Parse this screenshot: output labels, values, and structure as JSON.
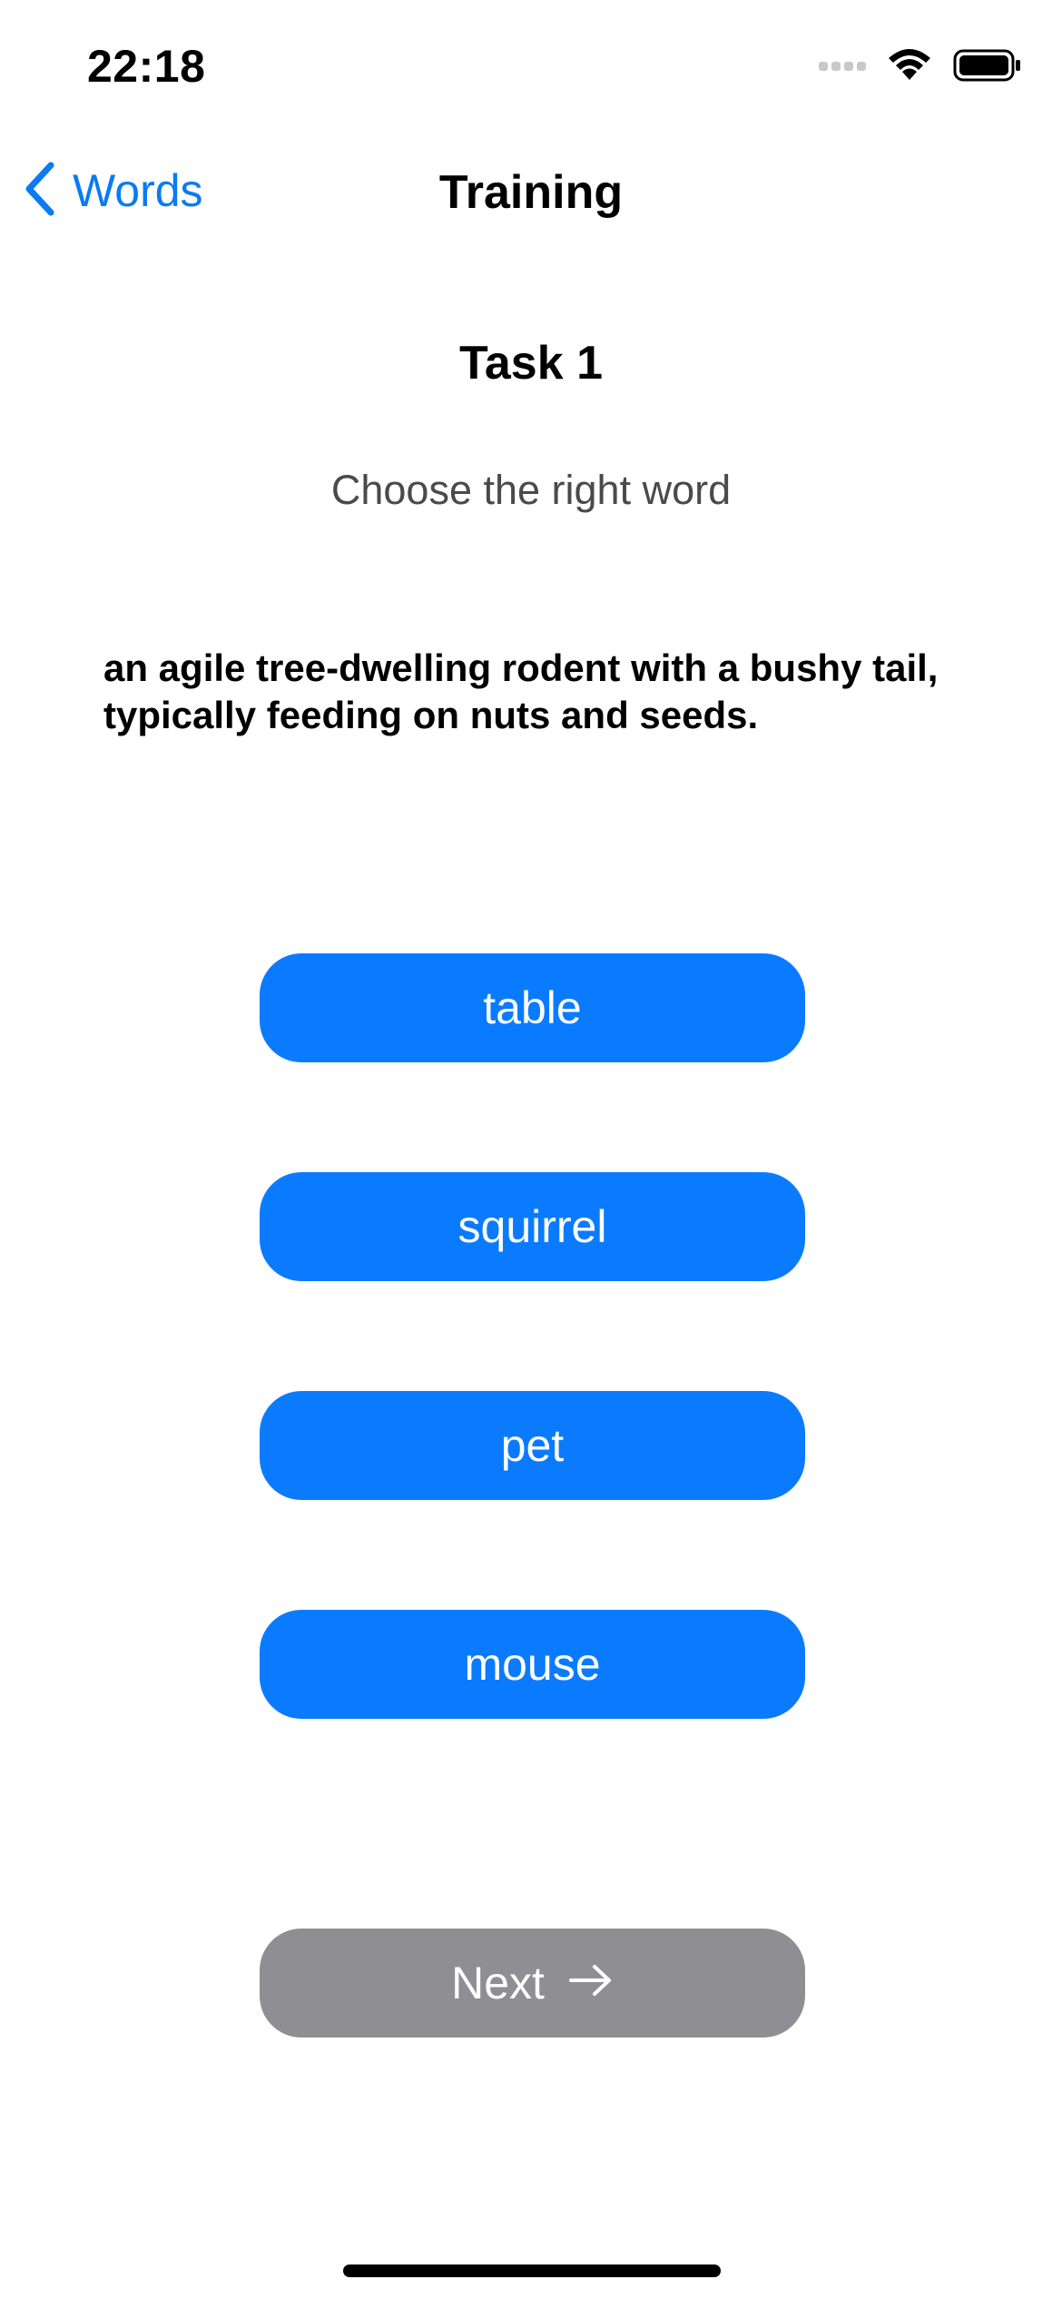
{
  "status_bar": {
    "time": "22:18"
  },
  "nav": {
    "back_label": "Words",
    "title": "Training"
  },
  "task": {
    "title": "Task 1",
    "subtitle": "Choose the right word",
    "definition": "an agile tree-dwelling rodent with a bushy tail, typically feeding on nuts and seeds."
  },
  "options": [
    "table",
    "squirrel",
    "pet",
    "mouse"
  ],
  "next_button": {
    "label": "Next",
    "enabled": false
  },
  "colors": {
    "accent": "#0a7bff",
    "disabled": "#8e8e93"
  }
}
